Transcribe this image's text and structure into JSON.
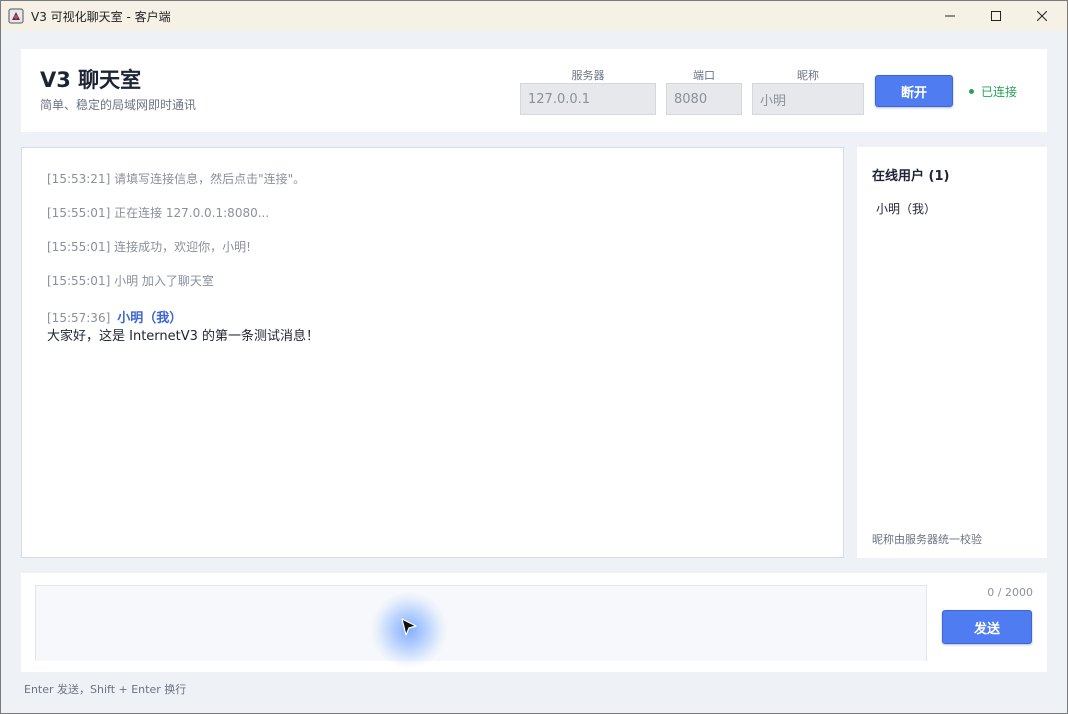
{
  "window": {
    "title": "V3 可视化聊天室 - 客户端"
  },
  "header": {
    "title": "V3 聊天室",
    "subtitle": "简单、稳定的局域网即时通讯",
    "server_label": "服务器",
    "server_value": "127.0.0.1",
    "port_label": "端口",
    "port_value": "8080",
    "nickname_label": "昵称",
    "nickname_value": "小明",
    "disconnect_label": "断开",
    "status_text": "已连接",
    "status_color": "#27a356"
  },
  "chat": {
    "system_messages": [
      "[15:53:21]  请填写连接信息，然后点击\"连接\"。",
      "[15:55:01]  正在连接 127.0.0.1:8080...",
      "[15:55:01]  连接成功，欢迎你，小明!",
      "[15:55:01]  小明 加入了聊天室"
    ],
    "message": {
      "time": "[15:57:36]",
      "author": "小明（我）",
      "text": "大家好，这是 InternetV3 的第一条测试消息！"
    }
  },
  "users": {
    "title": "在线用户 (1)",
    "items": [
      "小明（我）"
    ],
    "note": "昵称由服务器统一校验"
  },
  "composer": {
    "value": "",
    "char_count": "0 / 2000",
    "send_label": "发送",
    "hint": "Enter 发送，Shift + Enter 换行"
  },
  "colors": {
    "accent": "#4f7cf0",
    "background": "#eef1f6"
  }
}
